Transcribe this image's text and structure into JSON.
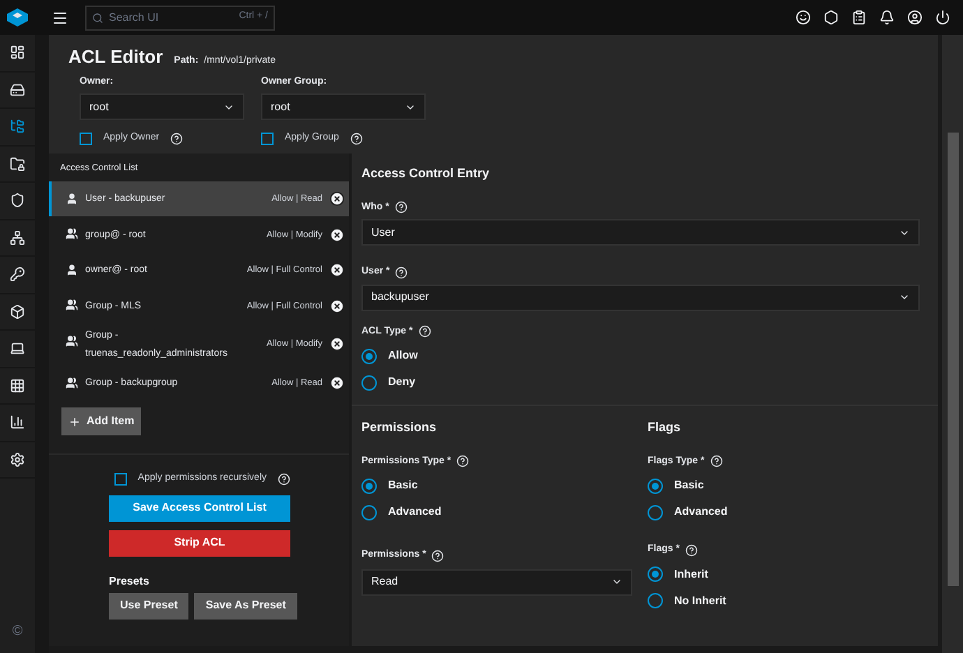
{
  "topbar": {
    "search_placeholder": "Search UI",
    "shortcut": "Ctrl + /"
  },
  "sidebar": {
    "items": [
      {
        "kind": "dashboard",
        "selected": false
      },
      {
        "kind": "storage",
        "selected": false
      },
      {
        "kind": "datasets",
        "selected": true
      },
      {
        "kind": "shares",
        "selected": false
      },
      {
        "kind": "shield",
        "selected": false
      },
      {
        "kind": "network",
        "selected": false
      },
      {
        "kind": "key",
        "selected": false
      },
      {
        "kind": "apps",
        "selected": false
      },
      {
        "kind": "vm",
        "selected": false
      },
      {
        "kind": "grid",
        "selected": false
      },
      {
        "kind": "reports",
        "selected": false
      },
      {
        "kind": "settings",
        "selected": false
      }
    ],
    "footer_symbol": "©"
  },
  "header": {
    "title": "ACL Editor",
    "path_label": "Path:",
    "path": "/mnt/vol1/private",
    "owner": {
      "label": "Owner:",
      "value": "root"
    },
    "owner_group": {
      "label": "Owner Group:",
      "value": "root"
    },
    "apply_owner": {
      "label": "Apply Owner",
      "checked": false
    },
    "apply_group": {
      "label": "Apply Group",
      "checked": false
    }
  },
  "acl_list": {
    "title": "Access Control List",
    "items": [
      {
        "kind": "user",
        "name": "User - backupuser",
        "permission": "Allow | Read",
        "selected": true
      },
      {
        "kind": "group",
        "name": "group@ - root",
        "permission": "Allow | Modify",
        "selected": false
      },
      {
        "kind": "user",
        "name": "owner@ - root",
        "permission": "Allow | Full Control",
        "selected": false
      },
      {
        "kind": "group",
        "name": "Group - MLS",
        "permission": "Allow | Full Control",
        "selected": false
      },
      {
        "kind": "group",
        "name": "Group - truenas_readonly_administrators",
        "permission": "Allow | Modify",
        "selected": false
      },
      {
        "kind": "group",
        "name": "Group - backupgroup",
        "permission": "Allow | Read",
        "selected": false
      }
    ],
    "add_button": "Add Item"
  },
  "actions": {
    "recursive": {
      "label": "Apply permissions recursively",
      "checked": false
    },
    "save_button": "Save Access Control List",
    "strip_button": "Strip ACL",
    "presets_title": "Presets",
    "preset_buttons": [
      "Use Preset",
      "Save As Preset"
    ]
  },
  "entry": {
    "title": "Access Control Entry",
    "who": {
      "label": "Who *",
      "value": "User"
    },
    "user": {
      "label": "User *",
      "value": "backupuser"
    },
    "acl_type": {
      "label": "ACL Type *",
      "options": [
        {
          "label": "Allow",
          "selected": true
        },
        {
          "label": "Deny",
          "selected": false
        }
      ]
    }
  },
  "permissions": {
    "title": "Permissions",
    "type": {
      "label": "Permissions Type *",
      "options": [
        {
          "label": "Basic",
          "selected": true
        },
        {
          "label": "Advanced",
          "selected": false
        }
      ]
    },
    "select": {
      "label": "Permissions *",
      "value": "Read"
    }
  },
  "flags": {
    "title": "Flags",
    "type": {
      "label": "Flags Type *",
      "options": [
        {
          "label": "Basic",
          "selected": true
        },
        {
          "label": "Advanced",
          "selected": false
        }
      ]
    },
    "flags": {
      "label": "Flags *",
      "options": [
        {
          "label": "Inherit",
          "selected": true
        },
        {
          "label": "No Inherit",
          "selected": false
        }
      ]
    }
  }
}
